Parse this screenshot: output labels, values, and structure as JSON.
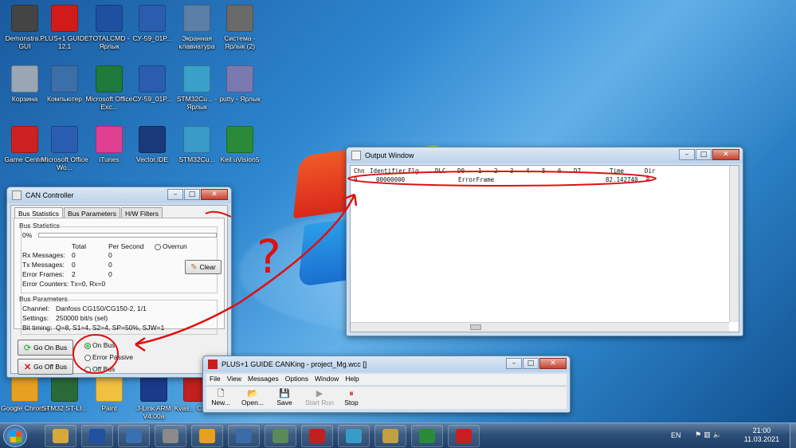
{
  "desktop": {
    "icons": [
      {
        "label": "Demonstra... GUI",
        "icon": "chip-board-icon",
        "color": "#444444"
      },
      {
        "label": "PLUS+1 GUIDE 12.1",
        "icon": "plus1-guide-icon",
        "color": "#d11a1a"
      },
      {
        "label": "TOTALCMD - Ярлык",
        "icon": "floppy-icon",
        "color": "#1e4fa0"
      },
      {
        "label": "СУ-59_01Р...",
        "icon": "word-doc-icon",
        "color": "#2a5db0"
      },
      {
        "label": "Экранная клавиатура",
        "icon": "keyboard-icon",
        "color": "#5b7fa6"
      },
      {
        "label": "Система - Ярлык (2)",
        "icon": "system-icon",
        "color": "#6a6a6a"
      },
      {
        "label": "Корзина",
        "icon": "recycle-bin-icon",
        "color": "#9aa6b4"
      },
      {
        "label": "Компьютер",
        "icon": "computer-icon",
        "color": "#3c6ea8"
      },
      {
        "label": "Microsoft Office Exc...",
        "icon": "excel-icon",
        "color": "#1e7a3a"
      },
      {
        "label": "СУ-59_01Р...",
        "icon": "word-doc-icon",
        "color": "#2a5db0"
      },
      {
        "label": "STM32Cu... - Ярлык",
        "icon": "cube-icon",
        "color": "#3aa0c8"
      },
      {
        "label": "putty - Ярлык",
        "icon": "putty-icon",
        "color": "#7a7ab0"
      },
      {
        "label": "Game Center",
        "icon": "game-center-icon",
        "color": "#cc2222"
      },
      {
        "label": "Microsoft Office Wo...",
        "icon": "word-icon",
        "color": "#2a5db0"
      },
      {
        "label": "iTunes",
        "icon": "itunes-icon",
        "color": "#e04090"
      },
      {
        "label": "Vector.IDE",
        "icon": "vector-ide-icon",
        "color": "#1a3a7a"
      },
      {
        "label": "STM32Cu...",
        "icon": "mx-icon",
        "color": "#3a9ac8"
      },
      {
        "label": "Keil uVision5",
        "icon": "keil-icon",
        "color": "#2a8a3a"
      },
      {
        "label": "Google Chrome",
        "icon": "chrome-icon",
        "color": "#e8a020"
      },
      {
        "label": "STM32 ST-LI...",
        "icon": "st-link-icon",
        "color": "#2a6a3a"
      },
      {
        "label": "Paint",
        "icon": "paint-icon",
        "color": "#f0c040"
      },
      {
        "label": "J-Link ARM V4.00a",
        "icon": "jlink-icon",
        "color": "#1a3a8a"
      },
      {
        "label": "Kvas... CanK...",
        "icon": "kvaser-icon",
        "color": "#c02020"
      }
    ]
  },
  "can_controller": {
    "title": "CAN Controller",
    "tabs": [
      "Bus Statistics",
      "Bus Parameters",
      "H/W Filters"
    ],
    "bus_statistics_label": "Bus Statistics",
    "load_percent": "0%",
    "load_fraction": 0,
    "col_total": "Total",
    "col_per_second": "Per Second",
    "overrun_label": "Overrun",
    "rows": [
      {
        "label": "Rx Messages:",
        "total": "0",
        "per_second": "0"
      },
      {
        "label": "Tx Messages:",
        "total": "0",
        "per_second": "0"
      },
      {
        "label": "Error Frames:",
        "total": "2",
        "per_second": "0"
      }
    ],
    "error_counters": "Error Counters:  Tx=0, Rx=0",
    "clear_label": "Clear",
    "bus_parameters_label": "Bus Parameters",
    "channel_label": "Channel:",
    "channel_value": "Danfoss CG150/CG150-2, 1/1",
    "settings_label": "Settings:",
    "settings_value": "250000 bit/s (sel)",
    "timing_label": "Bit timing:",
    "timing_value": "Q=8, S1=4, S2=4, SP=50%, SJW=1",
    "go_on_bus": "Go On Bus",
    "go_off_bus": "Go Off Bus",
    "states": [
      "On Bus",
      "Error Passive",
      "Off Bus"
    ],
    "active_state": "On Bus"
  },
  "output_window": {
    "title": "Output Window",
    "headers": [
      "Chn",
      "Identifier",
      "Flg",
      "DLC",
      "D0",
      "1",
      "2",
      "3",
      "4",
      "5",
      "6",
      "D7",
      "Time",
      "Dir"
    ],
    "row": {
      "chn": "0",
      "identifier": "00000000",
      "text": "ErrorFrame",
      "time": "82.142740",
      "dir": "R"
    }
  },
  "canking": {
    "title": "PLUS+1 GUIDE CANKing - project_Mg.wcc []",
    "menu": [
      "File",
      "View",
      "Messages",
      "Options",
      "Window",
      "Help"
    ],
    "tools": [
      {
        "label": "New...",
        "icon": "new-document-icon"
      },
      {
        "label": "Open...",
        "icon": "open-folder-icon"
      },
      {
        "label": "Save",
        "icon": "save-icon"
      },
      {
        "label": "Start Run",
        "icon": "start-run-icon"
      },
      {
        "label": "Stop",
        "icon": "stop-icon"
      }
    ]
  },
  "annotation": {
    "mark": "?",
    "color": "#dd1111"
  },
  "taskbar": {
    "language": "EN",
    "time": "21:00",
    "date": "11.03.2021",
    "items": [
      "explorer",
      "floppy",
      "control-panel",
      "calculator",
      "chrome",
      "network",
      "task-manager",
      "toolbox",
      "MX",
      "paint",
      "keil",
      "plus1"
    ]
  }
}
